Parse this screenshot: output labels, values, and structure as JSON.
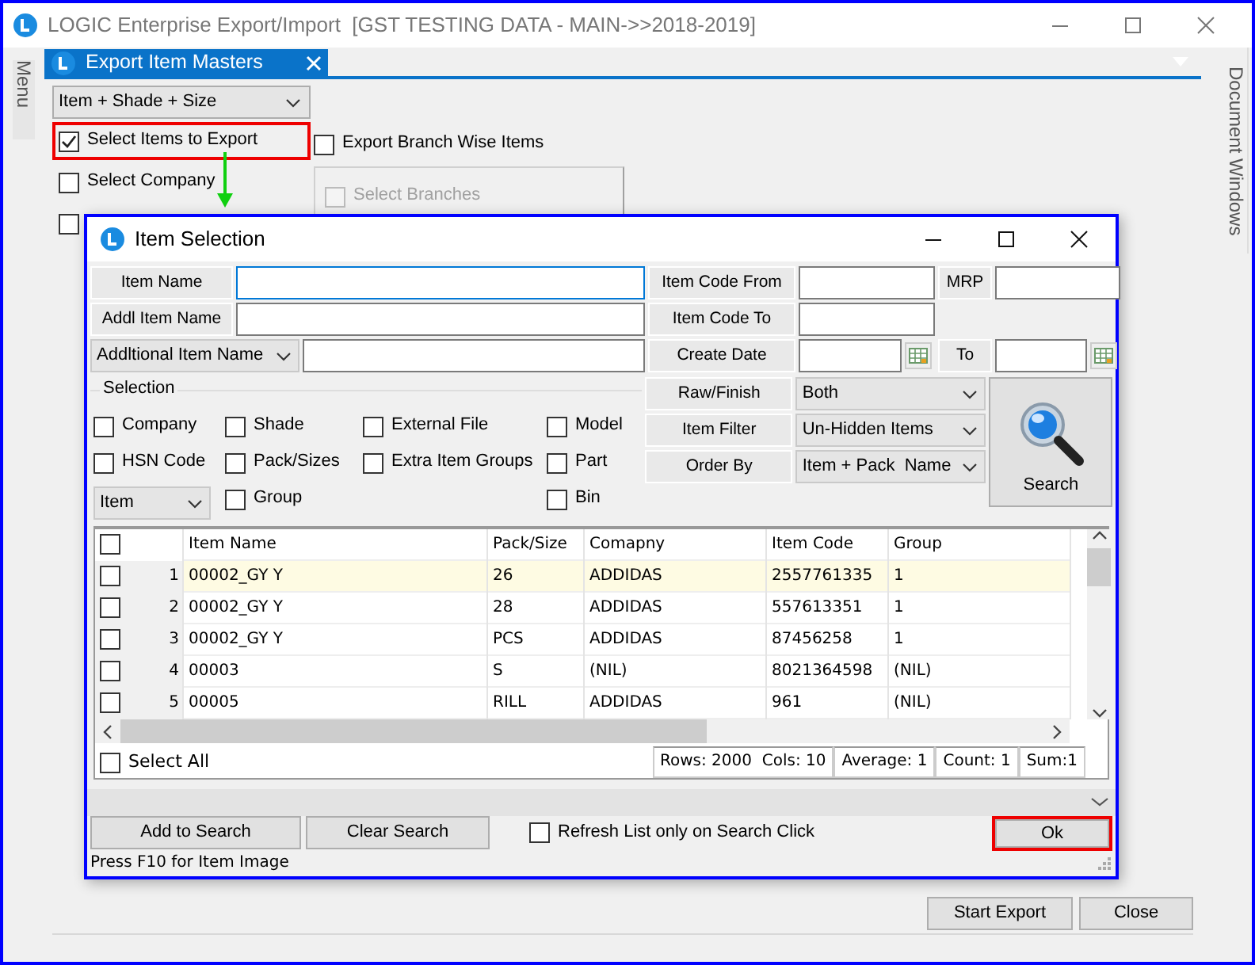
{
  "window": {
    "title": "LOGIC Enterprise Export/Import  [GST TESTING DATA - MAIN->>2018-2019]"
  },
  "left_panel": {
    "label": "Menu"
  },
  "right_panel": {
    "label": "Document Windows"
  },
  "tabs": [
    {
      "label": "Export Item Masters",
      "selected": true
    }
  ],
  "export_form": {
    "type_select": "Item + Shade + Size",
    "options": [
      {
        "label": "Select Items to Export",
        "checked": true,
        "highlighted": true
      },
      {
        "label": "Select Company",
        "checked": false,
        "highlighted": false
      },
      {
        "checked": false,
        "highlighted": false
      }
    ],
    "branch_wise": {
      "label": "Export Branch Wise Items",
      "checked": false
    },
    "branches": {
      "label": "Select Branches",
      "checked": false,
      "disabled": true
    },
    "buttons": [
      {
        "label": "Start Export"
      },
      {
        "label": "Close"
      }
    ]
  },
  "dialog": {
    "title": "Item Selection",
    "item_name": {
      "label": "Item Name"
    },
    "addl_item_name": {
      "label": "Addl Item Name"
    },
    "additional_select": {
      "value": "Addltional Item Name"
    },
    "item_code_from": {
      "label": "Item Code From"
    },
    "mrp": {
      "label": "MRP"
    },
    "item_code_to": {
      "label": "Item Code To"
    },
    "create_date": {
      "label": "Create Date"
    },
    "to_date": {
      "label": "To"
    },
    "selection": {
      "title": "Selection",
      "columns": [
        [
          {
            "kind": "checkbox",
            "label": "Company",
            "checked": false
          },
          {
            "kind": "checkbox",
            "label": "HSN Code",
            "checked": false
          },
          {
            "kind": "select",
            "value": "Item"
          }
        ],
        [
          {
            "kind": "checkbox",
            "label": "Shade",
            "checked": false
          },
          {
            "kind": "checkbox",
            "label": "Pack/Sizes",
            "checked": false
          },
          {
            "kind": "checkbox",
            "label": "Group",
            "checked": false
          }
        ],
        [
          {
            "kind": "checkbox",
            "label": "External File",
            "checked": false
          },
          {
            "kind": "checkbox",
            "label": "Extra Item Groups",
            "checked": false
          }
        ],
        [
          {
            "kind": "checkbox",
            "label": "Model",
            "checked": false
          },
          {
            "kind": "checkbox",
            "label": "Part",
            "checked": false
          },
          {
            "kind": "checkbox",
            "label": "Bin",
            "checked": false
          }
        ]
      ]
    },
    "filters": [
      {
        "label": "Raw/Finish",
        "value": "Both"
      },
      {
        "label": "Item Filter",
        "value": "Un-Hidden Items"
      },
      {
        "label": "Order By",
        "value": "Item + Pack  Name"
      }
    ],
    "search_button": {
      "label": "Search"
    },
    "grid": {
      "header_checked": false,
      "columns": [
        "Item Name",
        "Pack/Size",
        "Comapny",
        "Item Code",
        "Group"
      ],
      "rows": [
        {
          "number": "1",
          "checked": false,
          "selected": true,
          "cells": [
            "00002_GY Y",
            "26",
            "ADDIDAS",
            "2557761335",
            "1"
          ]
        },
        {
          "number": "2",
          "checked": false,
          "selected": false,
          "cells": [
            "00002_GY Y",
            "28",
            "ADDIDAS",
            "557613351",
            "1"
          ]
        },
        {
          "number": "3",
          "checked": false,
          "selected": false,
          "cells": [
            "00002_GY Y",
            "PCS",
            "ADDIDAS",
            "87456258",
            "1"
          ]
        },
        {
          "number": "4",
          "checked": false,
          "selected": false,
          "cells": [
            "00003",
            "S",
            "(NIL)",
            "8021364598",
            "(NIL)"
          ]
        },
        {
          "number": "5",
          "checked": false,
          "selected": false,
          "cells": [
            "00005",
            "RILL",
            "ADDIDAS",
            "961",
            "(NIL)"
          ]
        }
      ]
    },
    "select_all": {
      "label": "Select All",
      "checked": false
    },
    "summary": [
      "Rows: 2000  Cols: 10",
      "Average: 1",
      "Count: 1",
      "Sum:1"
    ],
    "buttons": [
      {
        "label": "Add to Search"
      },
      {
        "label": "Clear Search"
      }
    ],
    "refresh_option": {
      "label": "Refresh List only on Search Click",
      "checked": false
    },
    "ok_button": {
      "label": "Ok",
      "highlighted": true
    },
    "status": "Press F10 for Item Image"
  }
}
